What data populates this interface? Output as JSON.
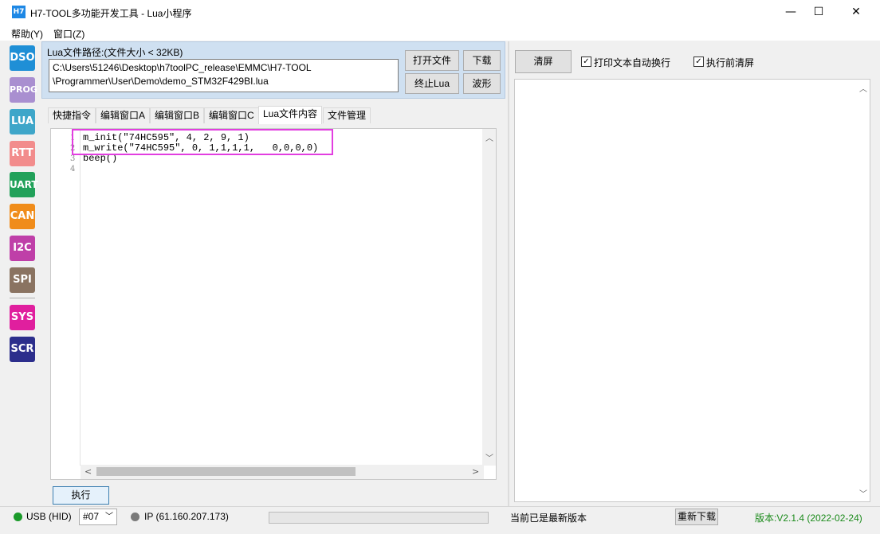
{
  "window": {
    "icon_text": "H7",
    "title": "H7-TOOL多功能开发工具 - Lua小程序",
    "minimize": "—",
    "maximize": "☐",
    "close": "✕"
  },
  "menu": [
    {
      "label": "帮助(Y)"
    },
    {
      "label": "窗口(Z)"
    }
  ],
  "sidebar": [
    {
      "label": "DSO",
      "color": "#1f8fd6"
    },
    {
      "label": "PROG",
      "color": "#a98fd0"
    },
    {
      "label": "LUA",
      "color": "#3ea6c9"
    },
    {
      "label": "RTT",
      "color": "#f28c8c"
    },
    {
      "label": "UART",
      "color": "#22a15a"
    },
    {
      "label": "CAN",
      "color": "#f08c1a"
    },
    {
      "label": "I2C",
      "color": "#bf3fa8"
    },
    {
      "label": "SPI",
      "color": "#8a7361"
    },
    {
      "label": "SYS",
      "color": "#e01f9e"
    },
    {
      "label": "SCR",
      "color": "#2c2e8c"
    }
  ],
  "path_panel": {
    "label": "Lua文件路径:(文件大小 < 32KB)",
    "path_line1": "C:\\Users\\51246\\Desktop\\h7toolPC_release\\EMMC\\H7-TOOL",
    "path_line2": "\\Programmer\\User\\Demo\\demo_STM32F429BI.lua",
    "open_file": "打开文件",
    "download": "下载",
    "stop_lua": "终止Lua",
    "waveform": "波形"
  },
  "tabs": [
    {
      "label": "快捷指令"
    },
    {
      "label": "编辑窗口A"
    },
    {
      "label": "编辑窗口B"
    },
    {
      "label": "编辑窗口C"
    },
    {
      "label": "Lua文件内容"
    },
    {
      "label": "文件管理"
    }
  ],
  "active_tab": "Lua文件内容",
  "editor": {
    "lines": [
      {
        "num": "1",
        "code": "m_init(\"74HC595\", 4, 2, 9, 1)"
      },
      {
        "num": "2",
        "code": "m_write(\"74HC595\", 0, 1,1,1,1,   0,0,0,0)"
      },
      {
        "num": "3",
        "code": "beep()"
      },
      {
        "num": "4",
        "code": ""
      }
    ],
    "highlight_color": "#e23ee0"
  },
  "execute_button": "执行",
  "right_panel": {
    "clear_button": "清屏",
    "wrap_checkbox": {
      "label": "打印文本自动换行",
      "checked": true
    },
    "clear_before_checkbox": {
      "label": "执行前清屏",
      "checked": true
    }
  },
  "statusbar": {
    "usb_label": "USB (HID)",
    "usb_color": "#1a9a2a",
    "device": "#07",
    "ip_label": "IP (61.160.207.173)",
    "ip_color": "#7a7a7a",
    "update_status": "当前已是最新版本",
    "redownload": "重新下载",
    "version": "版本:V2.1.4 (2022-02-24)",
    "version_color": "#1a8a1a"
  }
}
